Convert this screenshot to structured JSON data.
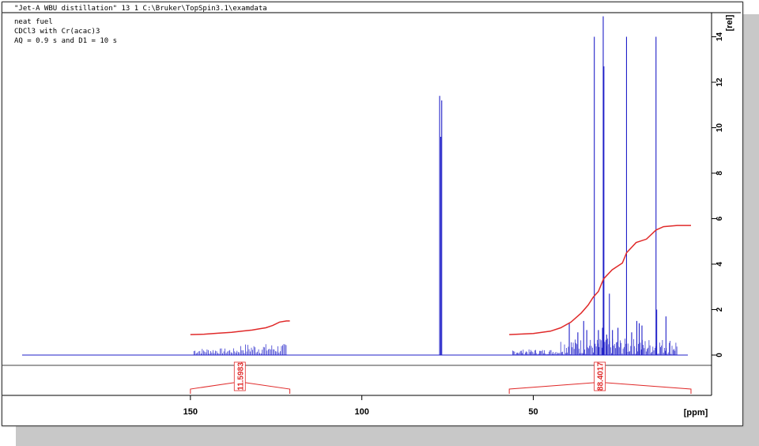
{
  "header": {
    "title_line": "\"Jet-A WBU distillation\"  13  1  C:\\Bruker\\TopSpin3.1\\examdata"
  },
  "annotations": [
    "neat fuel",
    "CDCl3 with Cr(acac)3",
    "AQ = 0.9 s and D1 = 10 s"
  ],
  "colors": {
    "spectrum": "#1f1fc8",
    "integral": "#e02a2a",
    "axis": "#000000",
    "frame": "#3a3a3a",
    "shadow": "#c8c8c8"
  },
  "chart_data": {
    "type": "line",
    "xlabel": "[ppm]",
    "ylabel": "[rel]",
    "xlim": [
      200,
      -2
    ],
    "ylim": [
      -1.8,
      15
    ],
    "x_ticks": [
      150,
      100,
      50
    ],
    "x_tick_labels": [
      "150",
      "100",
      "50"
    ],
    "y_ticks": [
      0,
      2,
      4,
      6,
      8,
      10,
      12,
      14
    ],
    "y_tick_labels": [
      "0",
      "2",
      "4",
      "6",
      "8",
      "10",
      "12",
      "14"
    ],
    "baseline": 0,
    "peaks": [
      {
        "ppm": 77.3,
        "height": 11.4
      },
      {
        "ppm": 77.0,
        "height": 9.6
      },
      {
        "ppm": 76.7,
        "height": 11.2
      },
      {
        "ppm": 39.5,
        "height": 1.4
      },
      {
        "ppm": 37.0,
        "height": 1.0
      },
      {
        "ppm": 35.3,
        "height": 1.5
      },
      {
        "ppm": 34.4,
        "height": 1.1
      },
      {
        "ppm": 32.2,
        "height": 14.0
      },
      {
        "ppm": 31.0,
        "height": 1.1
      },
      {
        "ppm": 29.8,
        "height": 1.2
      },
      {
        "ppm": 29.6,
        "height": 14.9
      },
      {
        "ppm": 29.4,
        "height": 12.7
      },
      {
        "ppm": 28.6,
        "height": 0.9
      },
      {
        "ppm": 27.8,
        "height": 2.7
      },
      {
        "ppm": 26.9,
        "height": 1.1
      },
      {
        "ppm": 25.3,
        "height": 1.2
      },
      {
        "ppm": 22.8,
        "height": 14.0
      },
      {
        "ppm": 21.3,
        "height": 1.0
      },
      {
        "ppm": 19.8,
        "height": 1.5
      },
      {
        "ppm": 19.1,
        "height": 1.4
      },
      {
        "ppm": 18.3,
        "height": 1.3
      },
      {
        "ppm": 14.2,
        "height": 14.0
      },
      {
        "ppm": 14.0,
        "height": 2.0
      },
      {
        "ppm": 11.3,
        "height": 1.7
      }
    ],
    "integrals": [
      {
        "label": "11.5983",
        "range": [
          150,
          121
        ],
        "label_ppm": 135.6,
        "x": [
          150,
          146,
          142,
          138,
          135,
          132,
          130,
          128,
          126,
          124,
          122,
          121
        ],
        "y": [
          0.9,
          0.92,
          0.96,
          1.0,
          1.05,
          1.1,
          1.15,
          1.2,
          1.3,
          1.45,
          1.5,
          1.5
        ]
      },
      {
        "label": "88.4017",
        "range": [
          57,
          4
        ],
        "label_ppm": 30.6,
        "x": [
          57,
          50,
          45,
          42,
          39,
          36,
          34,
          32.5,
          31,
          29.5,
          27,
          24,
          22.8,
          20,
          17,
          14.2,
          12,
          8,
          4
        ],
        "y": [
          0.9,
          0.95,
          1.05,
          1.2,
          1.45,
          1.85,
          2.2,
          2.55,
          2.8,
          3.35,
          3.75,
          4.05,
          4.5,
          4.95,
          5.1,
          5.5,
          5.65,
          5.7,
          5.7
        ]
      }
    ]
  }
}
